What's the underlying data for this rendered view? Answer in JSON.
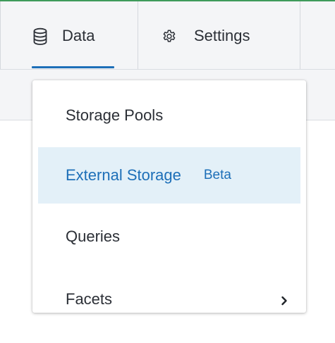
{
  "tabs": [
    {
      "label": "Data",
      "icon": "database-icon",
      "active": true
    },
    {
      "label": "Settings",
      "icon": "gear-icon",
      "active": false
    }
  ],
  "dropdown": {
    "items": [
      {
        "label": "Storage Pools"
      },
      {
        "label": "External Storage",
        "badge": "Beta",
        "active": true
      },
      {
        "label": "Queries"
      },
      {
        "label": "Facets",
        "submenu_icon": "chevron-right-icon"
      }
    ]
  },
  "colors": {
    "accent": "#1d6fb8",
    "active_bg": "#e3f0f8",
    "top_border": "#3f9b5a",
    "tabbar_bg": "#f4f5f7",
    "text": "#2b2f36"
  }
}
